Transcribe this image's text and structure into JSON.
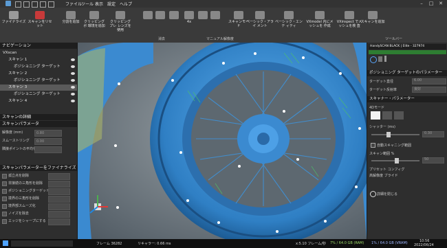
{
  "menu": {
    "items": [
      "ファイル",
      "ツール",
      "表示",
      "設定",
      "ヘルプ"
    ]
  },
  "ribbon": {
    "buttons": [
      {
        "label": "ファイナライズ",
        "icon": "finalize-icon",
        "color": "#9a9a9a"
      },
      {
        "label": "スキャンをリセット",
        "icon": "reset-scan-icon",
        "color": "#c83a3a"
      },
      {
        "label": "分割を追加",
        "icon": "add-split-icon",
        "color": "#888"
      },
      {
        "label": "クリッピングボ 環境を追加",
        "icon": "clipping-box-icon",
        "color": "#888"
      },
      {
        "label": "クリッピングプレ レンズを使用",
        "icon": "clipping-plane-icon",
        "color": "#888"
      },
      {
        "label": "",
        "icon": "pen-icon",
        "color": "#888"
      },
      {
        "label": "",
        "icon": "brush-icon",
        "color": "#888"
      },
      {
        "label": "",
        "icon": "lasso-icon",
        "color": "#888"
      },
      {
        "label": "4x",
        "icon": "zoom-4x-icon",
        "color": "#888"
      },
      {
        "label": "",
        "icon": "resolution-icon",
        "color": "#888"
      },
      {
        "label": "",
        "icon": "quality-icon",
        "color": "#888"
      },
      {
        "label": "スキャンモード",
        "icon": "scan-mode-icon",
        "color": "#888"
      },
      {
        "label": "ベーシック・アライ メント",
        "icon": "align-icon",
        "color": "#888"
      },
      {
        "label": "ベーシック・エンテ ィティ",
        "icon": "entity-icon",
        "color": "#888"
      },
      {
        "label": "VXmodel 内にメッシュを 作成",
        "icon": "vxmodel-icon",
        "color": "#888"
      },
      {
        "label": "VXinspect でメッシュを検 査",
        "icon": "vxinspect-icon",
        "color": "#888"
      },
      {
        "label": "スキャンを追加",
        "icon": "add-scan-icon",
        "color": "#888"
      }
    ],
    "group_labels": [
      "消去",
      "マニュアル解像度",
      "ツールバー"
    ]
  },
  "left_panel": {
    "nav_header": "ナビゲーション",
    "tree": [
      {
        "label": "VXscan",
        "level": 0
      },
      {
        "label": "スキャン 1",
        "level": 1
      },
      {
        "label": "ポジショニング ターゲット",
        "level": 2
      },
      {
        "label": "スキャン 2",
        "level": 1
      },
      {
        "label": "ポジショニング ターゲット",
        "level": 2
      },
      {
        "label": "スキャン 3",
        "level": 1
      },
      {
        "label": "ポジショニング ターゲット",
        "level": 2
      },
      {
        "label": "スキャン 4",
        "level": 1
      }
    ],
    "scan_details_header": "スキャンの詳細",
    "scan_params_header": "スキャンパラメータ",
    "params": [
      {
        "label": "解像度 (mm)",
        "value": "0.80"
      },
      {
        "label": "スムーストリング",
        "value": "0.00"
      },
      {
        "label": "隣接ポイントの平均化",
        "value": ""
      }
    ],
    "postproc_header": "スキャンパラメーターをファイナライズ",
    "options": [
      {
        "label": "孤立点を削除",
        "value": ""
      },
      {
        "label": "非接続の三角形を削除",
        "value": ""
      },
      {
        "label": "ポジショニングターゲットを充填",
        "value": ""
      },
      {
        "label": "境界の三角形を削除",
        "value": ""
      },
      {
        "label": "境界部スムーズ化",
        "value": ""
      },
      {
        "label": "ノイズを除去",
        "value": ""
      },
      {
        "label": "エッジをシャープにする",
        "value": ""
      }
    ]
  },
  "right_panel": {
    "device": "HandySCAN BLACK | Elite - 327974",
    "positioning_header": "ポジショニング ターゲットのパラメーター",
    "positioning_rows": [
      {
        "label": "ターゲット直径",
        "value": "6.00"
      },
      {
        "label": "ターゲット反射率",
        "value": "良好"
      }
    ],
    "scanner_header": "スキャナー・パラメーター",
    "scanner_rows": {
      "mode": "4Dモード",
      "shutter": "シャッター (ms)",
      "shutter_value": "0.30",
      "auto_shutter": "自動スキャニング範囲",
      "scan_resolution": "スキャン範囲 %",
      "scan_res_value": "50",
      "preset": "プリセット コンフィグ",
      "preset_value": "高解像度 ブライド"
    },
    "start_label": "詳細を閉じる"
  },
  "status": {
    "left": "フレーム 36282",
    "mid": "リキャラー: 0.66 ms",
    "right": "x:5.10 フレーム/秒",
    "mem1": "7% / 64.0 GB (RAM)",
    "mem2": "1% / 64.0 GB (VRAM)",
    "time": "10:56",
    "date": "2022/06/24"
  },
  "colors": {
    "scan_blue": "#3c8fd6",
    "accent_green": "#4caf50",
    "ribbon_bg": "#3a3a3a"
  }
}
